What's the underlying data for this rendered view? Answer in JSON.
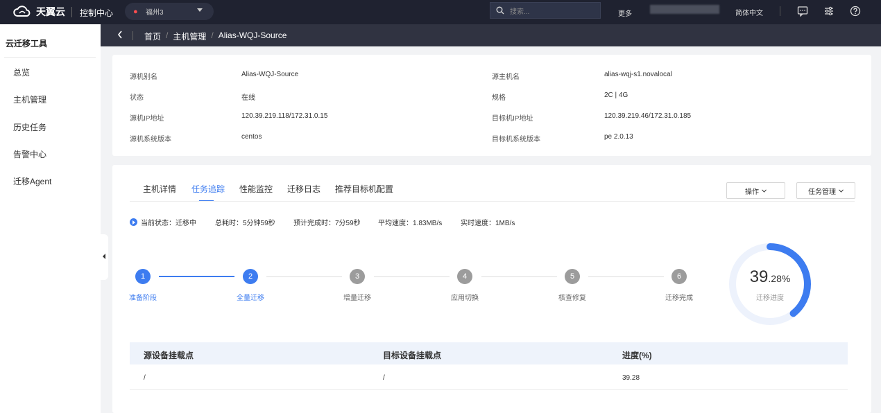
{
  "topbar": {
    "brand": "天翼云",
    "console": "控制中心",
    "region": "福州3",
    "search_placeholder": "搜索...",
    "more": "更多",
    "language": "简体中文"
  },
  "sidebar": {
    "title": "云迁移工具",
    "items": [
      {
        "label": "总览"
      },
      {
        "label": "主机管理"
      },
      {
        "label": "历史任务"
      },
      {
        "label": "告警中心"
      },
      {
        "label": "迁移Agent"
      }
    ]
  },
  "breadcrumb": {
    "items": [
      "首页",
      "主机管理",
      "Alias-WQJ-Source"
    ]
  },
  "info": {
    "left": [
      {
        "label": "源机别名",
        "value": "Alias-WQJ-Source"
      },
      {
        "label": "状态",
        "value": "在线"
      },
      {
        "label": "源机IP地址",
        "value": "120.39.219.118/172.31.0.15"
      },
      {
        "label": "源机系统版本",
        "value": "centos"
      }
    ],
    "right": [
      {
        "label": "源主机名",
        "value": "alias-wqj-s1.novalocal"
      },
      {
        "label": "规格",
        "value": "2C | 4G"
      },
      {
        "label": "目标机IP地址",
        "value": "120.39.219.46/172.31.0.185"
      },
      {
        "label": "目标机系统版本",
        "value": "pe 2.0.13"
      }
    ]
  },
  "tabs": [
    {
      "label": "主机详情"
    },
    {
      "label": "任务追踪"
    },
    {
      "label": "性能监控"
    },
    {
      "label": "迁移日志"
    },
    {
      "label": "推荐目标机配置"
    }
  ],
  "actions": {
    "operate": "操作",
    "task_manage": "任务管理"
  },
  "status": {
    "current": "当前状态：迁移中",
    "elapsed": "总耗时：5分钟59秒",
    "eta": "预计完成时：7分59秒",
    "avg_speed": "平均速度：1.83MB/s",
    "realtime_speed": "实时速度：1MB/s"
  },
  "steps": [
    {
      "num": "1",
      "label": "准备阶段"
    },
    {
      "num": "2",
      "label": "全量迁移"
    },
    {
      "num": "3",
      "label": "增量迁移"
    },
    {
      "num": "4",
      "label": "应用切换"
    },
    {
      "num": "5",
      "label": "核查修复"
    },
    {
      "num": "6",
      "label": "迁移完成"
    }
  ],
  "progress": {
    "percent": 39.28,
    "int_part": "39",
    "dec_part": ".28%",
    "label": "迁移进度",
    "track_color": "#edf2fc",
    "fill_color": "#3d7cf0"
  },
  "table": {
    "headers": [
      "源设备挂载点",
      "目标设备挂载点",
      "进度(%)"
    ],
    "rows": [
      [
        "/",
        "/",
        "39.28"
      ]
    ]
  }
}
